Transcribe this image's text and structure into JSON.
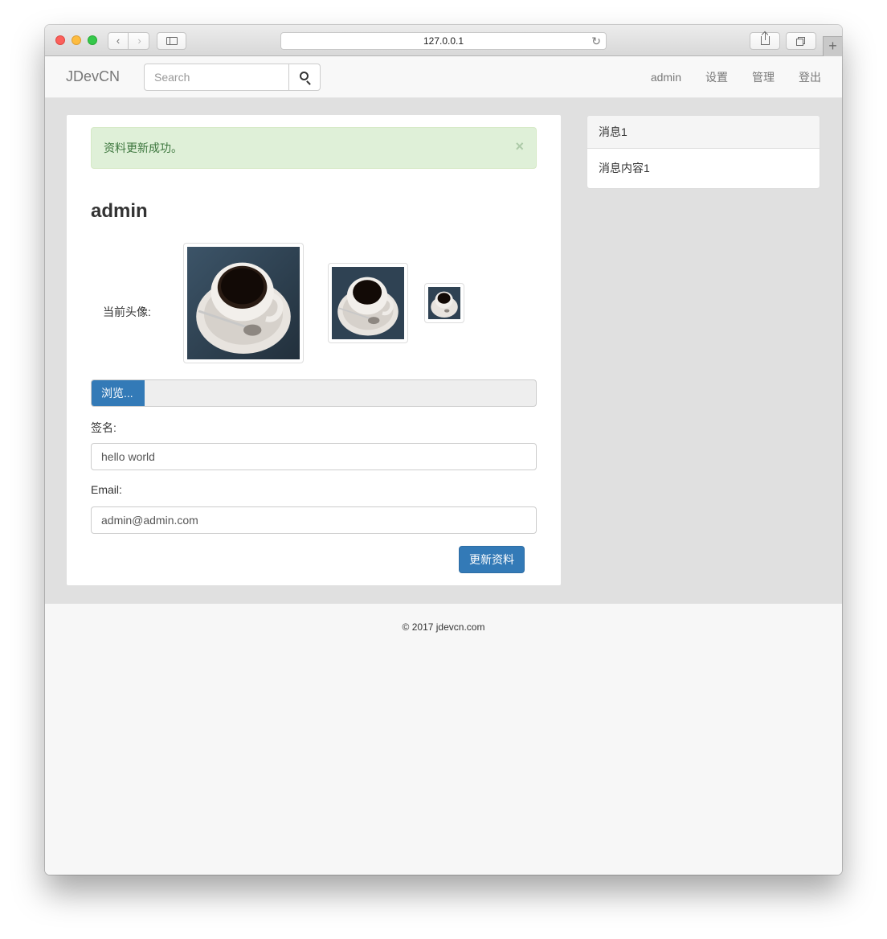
{
  "browser": {
    "address": "127.0.0.1",
    "back_icon": "chevron-left-icon",
    "forward_icon": "chevron-right-icon",
    "new_tab_label": "+"
  },
  "navbar": {
    "brand": "JDevCN",
    "search_placeholder": "Search",
    "links": [
      "admin",
      "设置",
      "管理",
      "登出"
    ]
  },
  "alert": {
    "message": "资料更新成功。",
    "close": "×"
  },
  "profile": {
    "username": "admin",
    "avatar_label": "当前头像:",
    "browse_label": "浏览...",
    "signature_label": "签名:",
    "signature_value": "hello world",
    "email_label": "Email:",
    "email_value": "admin@admin.com",
    "submit_label": "更新资料"
  },
  "messages": {
    "title": "消息1",
    "content": "消息内容1"
  },
  "footer": {
    "copyright": "© 2017 jdevcn.com"
  },
  "colors": {
    "primary": "#337ab7",
    "alert_bg": "#dff0d8",
    "alert_text": "#3c763d",
    "main_bg": "#e0e0e0"
  }
}
